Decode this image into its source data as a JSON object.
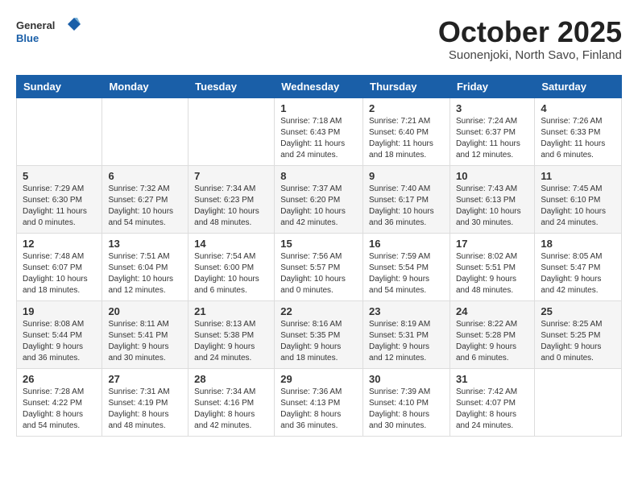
{
  "header": {
    "logo_general": "General",
    "logo_blue": "Blue",
    "title": "October 2025",
    "location": "Suonenjoki, North Savo, Finland"
  },
  "weekdays": [
    "Sunday",
    "Monday",
    "Tuesday",
    "Wednesday",
    "Thursday",
    "Friday",
    "Saturday"
  ],
  "weeks": [
    [
      {
        "day": "",
        "info": ""
      },
      {
        "day": "",
        "info": ""
      },
      {
        "day": "",
        "info": ""
      },
      {
        "day": "1",
        "info": "Sunrise: 7:18 AM\nSunset: 6:43 PM\nDaylight: 11 hours\nand 24 minutes."
      },
      {
        "day": "2",
        "info": "Sunrise: 7:21 AM\nSunset: 6:40 PM\nDaylight: 11 hours\nand 18 minutes."
      },
      {
        "day": "3",
        "info": "Sunrise: 7:24 AM\nSunset: 6:37 PM\nDaylight: 11 hours\nand 12 minutes."
      },
      {
        "day": "4",
        "info": "Sunrise: 7:26 AM\nSunset: 6:33 PM\nDaylight: 11 hours\nand 6 minutes."
      }
    ],
    [
      {
        "day": "5",
        "info": "Sunrise: 7:29 AM\nSunset: 6:30 PM\nDaylight: 11 hours\nand 0 minutes."
      },
      {
        "day": "6",
        "info": "Sunrise: 7:32 AM\nSunset: 6:27 PM\nDaylight: 10 hours\nand 54 minutes."
      },
      {
        "day": "7",
        "info": "Sunrise: 7:34 AM\nSunset: 6:23 PM\nDaylight: 10 hours\nand 48 minutes."
      },
      {
        "day": "8",
        "info": "Sunrise: 7:37 AM\nSunset: 6:20 PM\nDaylight: 10 hours\nand 42 minutes."
      },
      {
        "day": "9",
        "info": "Sunrise: 7:40 AM\nSunset: 6:17 PM\nDaylight: 10 hours\nand 36 minutes."
      },
      {
        "day": "10",
        "info": "Sunrise: 7:43 AM\nSunset: 6:13 PM\nDaylight: 10 hours\nand 30 minutes."
      },
      {
        "day": "11",
        "info": "Sunrise: 7:45 AM\nSunset: 6:10 PM\nDaylight: 10 hours\nand 24 minutes."
      }
    ],
    [
      {
        "day": "12",
        "info": "Sunrise: 7:48 AM\nSunset: 6:07 PM\nDaylight: 10 hours\nand 18 minutes."
      },
      {
        "day": "13",
        "info": "Sunrise: 7:51 AM\nSunset: 6:04 PM\nDaylight: 10 hours\nand 12 minutes."
      },
      {
        "day": "14",
        "info": "Sunrise: 7:54 AM\nSunset: 6:00 PM\nDaylight: 10 hours\nand 6 minutes."
      },
      {
        "day": "15",
        "info": "Sunrise: 7:56 AM\nSunset: 5:57 PM\nDaylight: 10 hours\nand 0 minutes."
      },
      {
        "day": "16",
        "info": "Sunrise: 7:59 AM\nSunset: 5:54 PM\nDaylight: 9 hours\nand 54 minutes."
      },
      {
        "day": "17",
        "info": "Sunrise: 8:02 AM\nSunset: 5:51 PM\nDaylight: 9 hours\nand 48 minutes."
      },
      {
        "day": "18",
        "info": "Sunrise: 8:05 AM\nSunset: 5:47 PM\nDaylight: 9 hours\nand 42 minutes."
      }
    ],
    [
      {
        "day": "19",
        "info": "Sunrise: 8:08 AM\nSunset: 5:44 PM\nDaylight: 9 hours\nand 36 minutes."
      },
      {
        "day": "20",
        "info": "Sunrise: 8:11 AM\nSunset: 5:41 PM\nDaylight: 9 hours\nand 30 minutes."
      },
      {
        "day": "21",
        "info": "Sunrise: 8:13 AM\nSunset: 5:38 PM\nDaylight: 9 hours\nand 24 minutes."
      },
      {
        "day": "22",
        "info": "Sunrise: 8:16 AM\nSunset: 5:35 PM\nDaylight: 9 hours\nand 18 minutes."
      },
      {
        "day": "23",
        "info": "Sunrise: 8:19 AM\nSunset: 5:31 PM\nDaylight: 9 hours\nand 12 minutes."
      },
      {
        "day": "24",
        "info": "Sunrise: 8:22 AM\nSunset: 5:28 PM\nDaylight: 9 hours\nand 6 minutes."
      },
      {
        "day": "25",
        "info": "Sunrise: 8:25 AM\nSunset: 5:25 PM\nDaylight: 9 hours\nand 0 minutes."
      }
    ],
    [
      {
        "day": "26",
        "info": "Sunrise: 7:28 AM\nSunset: 4:22 PM\nDaylight: 8 hours\nand 54 minutes."
      },
      {
        "day": "27",
        "info": "Sunrise: 7:31 AM\nSunset: 4:19 PM\nDaylight: 8 hours\nand 48 minutes."
      },
      {
        "day": "28",
        "info": "Sunrise: 7:34 AM\nSunset: 4:16 PM\nDaylight: 8 hours\nand 42 minutes."
      },
      {
        "day": "29",
        "info": "Sunrise: 7:36 AM\nSunset: 4:13 PM\nDaylight: 8 hours\nand 36 minutes."
      },
      {
        "day": "30",
        "info": "Sunrise: 7:39 AM\nSunset: 4:10 PM\nDaylight: 8 hours\nand 30 minutes."
      },
      {
        "day": "31",
        "info": "Sunrise: 7:42 AM\nSunset: 4:07 PM\nDaylight: 8 hours\nand 24 minutes."
      },
      {
        "day": "",
        "info": ""
      }
    ]
  ]
}
